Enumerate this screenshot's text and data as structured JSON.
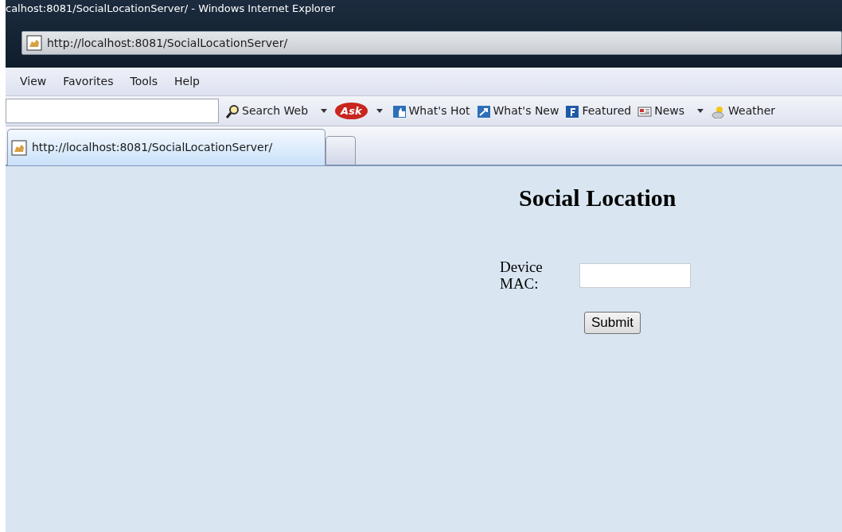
{
  "window": {
    "title": "calhost:8081/SocialLocationServer/ - Windows Internet Explorer"
  },
  "address_bar": {
    "value": "http://localhost:8081/SocialLocationServer/"
  },
  "menu": [
    "View",
    "Favorites",
    "Tools",
    "Help"
  ],
  "toolbar": {
    "items": [
      {
        "label": "Search Web",
        "kind": "dropdown"
      },
      {
        "label": "Ask",
        "kind": "logo"
      },
      {
        "label": "What's Hot",
        "kind": "button"
      },
      {
        "label": "What's New",
        "kind": "button"
      },
      {
        "label": "Featured",
        "kind": "button"
      },
      {
        "label": "News",
        "kind": "dropdown"
      },
      {
        "label": "Weather",
        "kind": "button"
      }
    ]
  },
  "tabs": [
    {
      "label": "http://localhost:8081/SocialLocationServer/",
      "selected": true
    }
  ],
  "page": {
    "heading": "Social Location",
    "field_label": "Device MAC:",
    "submit": "Submit"
  }
}
